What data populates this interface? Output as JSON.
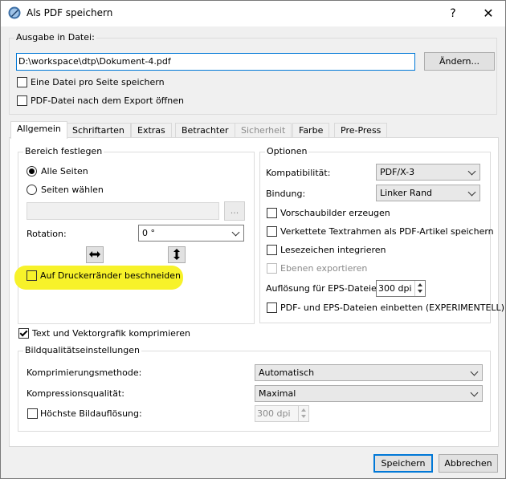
{
  "window": {
    "title": "Als PDF speichern",
    "help_label": "?",
    "close_label": "✕"
  },
  "output": {
    "legend": "Ausgabe in Datei:",
    "path": "D:\\workspace\\dtp\\Dokument-4.pdf",
    "change_label": "Ändern...",
    "one_file_per_page": {
      "label": "Eine Datei pro Seite speichern",
      "checked": false
    },
    "open_after_export": {
      "label": "PDF-Datei nach dem Export öffnen",
      "checked": false
    }
  },
  "tabs": [
    {
      "label": "Allgemein",
      "active": true,
      "enabled": true
    },
    {
      "label": "Schriftarten",
      "active": false,
      "enabled": true
    },
    {
      "label": "Extras",
      "active": false,
      "enabled": true
    },
    {
      "label": "Betrachter",
      "active": false,
      "enabled": true
    },
    {
      "label": "Sicherheit",
      "active": false,
      "enabled": false
    },
    {
      "label": "Farbe",
      "active": false,
      "enabled": true
    },
    {
      "label": "Pre-Press",
      "active": false,
      "enabled": true
    }
  ],
  "range": {
    "legend": "Bereich festlegen",
    "all_pages": "Alle Seiten",
    "choose_pages": "Seiten wählen",
    "page_input_placeholder": "",
    "browse_label": "...",
    "rotation_label": "Rotation:",
    "rotation_value": "0 °",
    "flip_h_icon": "horizontal-arrows-icon",
    "flip_v_icon": "vertical-arrows-icon",
    "clip_printer_margins": {
      "label": "Auf Druckerränder beschneiden",
      "checked": false
    },
    "highlight_color": "#f7f22a"
  },
  "options": {
    "legend": "Optionen",
    "compatibility_label": "Kompatibilität:",
    "compatibility_value": "PDF/X-3",
    "binding_label": "Bindung:",
    "binding_value": "Linker Rand",
    "thumbnails": {
      "label": "Vorschaubilder erzeugen",
      "checked": false
    },
    "linked_frames": {
      "label": "Verkettete Textrahmen als PDF-Artikel speichern",
      "checked": false
    },
    "bookmarks": {
      "label": "Lesezeichen integrieren",
      "checked": false
    },
    "export_layers": {
      "label": "Ebenen exportieren",
      "checked": false,
      "enabled": false
    },
    "eps_resolution_label": "Auflösung für EPS-Dateien:",
    "eps_resolution_value": "300 dpi",
    "embed_pdf_eps": {
      "label": "PDF- und EPS-Dateien einbetten (EXPERIMENTELL)",
      "checked": false
    }
  },
  "compress_text_vector": {
    "label": "Text und Vektorgrafik komprimieren",
    "checked": true
  },
  "image_quality": {
    "legend": "Bildqualitätseinstellungen",
    "method_label": "Komprimierungsmethode:",
    "method_value": "Automatisch",
    "quality_label": "Kompressionsqualität:",
    "quality_value": "Maximal",
    "max_resolution": {
      "label": "Höchste Bildauflösung:",
      "checked": false
    },
    "max_resolution_value": "300 dpi"
  },
  "footer": {
    "save_label": "Speichern",
    "cancel_label": "Abbrechen"
  },
  "colors": {
    "accent": "#0078d7"
  }
}
